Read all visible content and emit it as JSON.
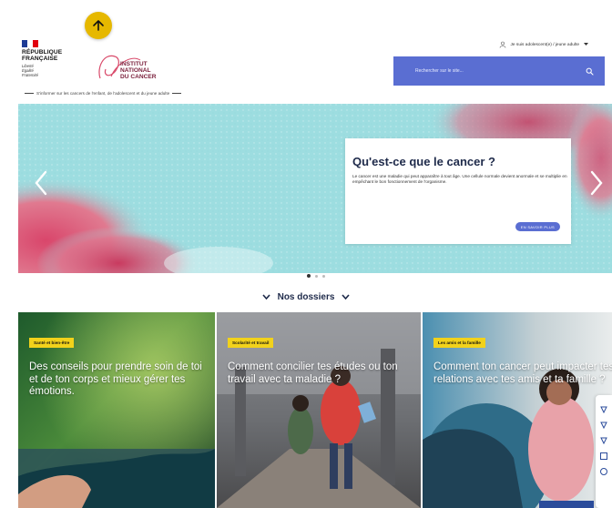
{
  "header": {
    "republique_lines": [
      "RÉPUBLIQUE",
      "FRANÇAISE"
    ],
    "motto_lines": [
      "Liberté",
      "Égalité",
      "Fraternité"
    ],
    "institut_lines": [
      "INSTITUT",
      "NATIONAL",
      "DU CANCER"
    ],
    "tagline": "S'informer sur les cancers de l'enfant, de l'adolescent et du jeune adulte",
    "audience_select": "Je suis adolescent(e) / jeune adulte",
    "search_placeholder": "Rechercher sur le site..."
  },
  "hero": {
    "title": "Qu'est-ce que le cancer ?",
    "text": "Le cancer est une maladie qui peut apparaître à tout âge. Une cellule normale devient anormale et se multiplie en empêchant le bon fonctionnement de l'organisme.",
    "button": "EN SAVOIR PLUS",
    "slide_count": 3,
    "active_slide": 1
  },
  "section": {
    "title": "Nos dossiers"
  },
  "cards": [
    {
      "badge": "Santé et bien-être",
      "title": "Des conseils pour prendre soin de toi et de ton corps et mieux gérer tes émotions."
    },
    {
      "badge": "Scolarité et travail",
      "title": "Comment concilier tes études ou ton travail avec ta maladie ?"
    },
    {
      "badge": "Les amis et la famille",
      "title": "Comment ton cancer peut impacter tes relations avec tes amis et ta famille ?"
    }
  ],
  "colors": {
    "accent_yellow": "#f2d21b",
    "brand_blue": "#5a6ed2",
    "navy": "#1e2a4a",
    "scroll_button": "#e6b800"
  },
  "icons": [
    "arrow-up-icon",
    "chevron-down-icon",
    "search-icon",
    "user-icon",
    "chevron-left-icon",
    "chevron-right-icon"
  ]
}
